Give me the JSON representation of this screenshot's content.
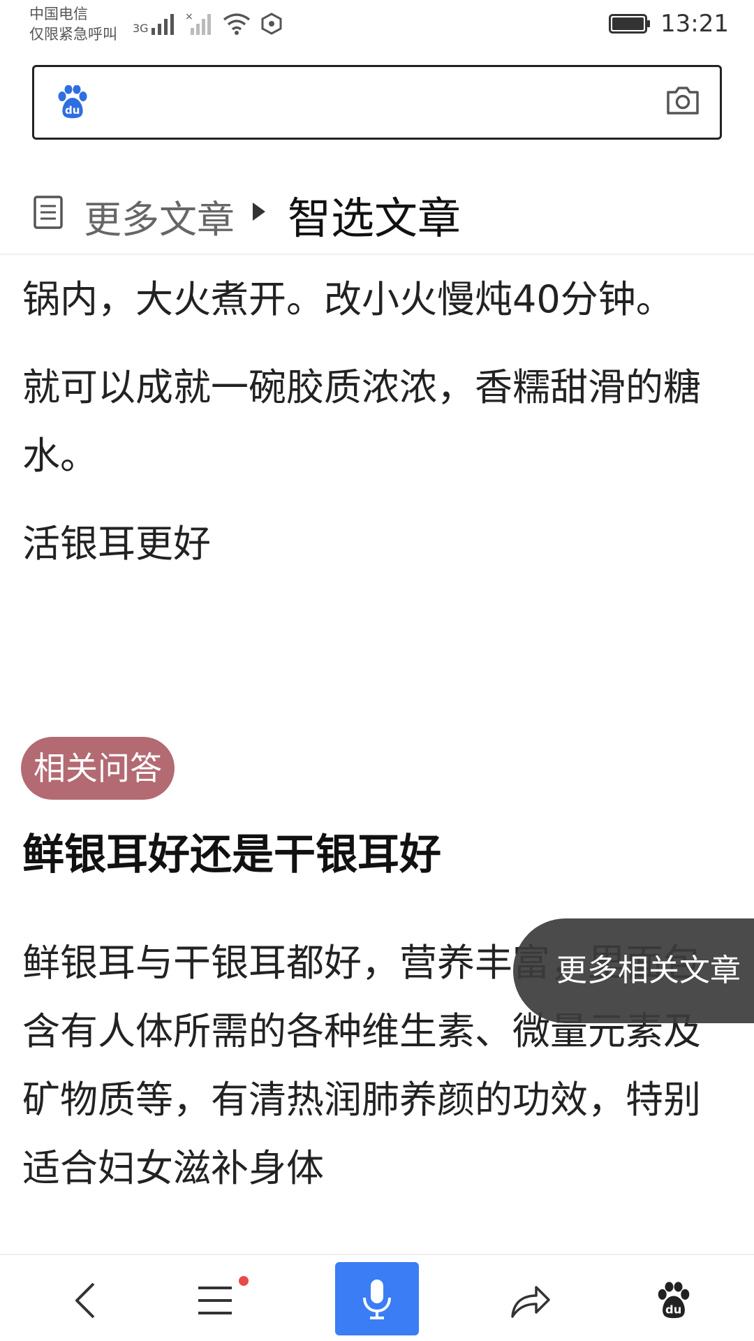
{
  "status_bar": {
    "carrier_line1": "中国电信",
    "carrier_line2": "仅限紧急呼叫",
    "network": "3G",
    "time": "13:21"
  },
  "search": {
    "placeholder": ""
  },
  "article_nav": {
    "more_articles": "更多文章",
    "current": "智选文章"
  },
  "article": {
    "paragraphs": [
      "锅内，大火煮开。改小火慢炖40分钟。",
      "就可以成就一碗胶质浓浓，香糯甜滑的糖水。",
      "活银耳更好"
    ]
  },
  "related_qa": {
    "tag": "相关问答",
    "title": "鲜银耳好还是干银耳好",
    "body": "鲜银耳与干银耳都好，营养丰富，里面包含有人体所需的各种维生素、微量元素及矿物质等，有清热润肺养颜的功效，特别适合妇女滋补身体"
  },
  "floating": {
    "more_related": "更多相关文章"
  },
  "colors": {
    "tag_bg": "#b36a72",
    "voice_button": "#3b7df5",
    "baidu_blue": "#2f6ee0",
    "notification_dot": "#e84a4a"
  },
  "icons": {
    "back": "chevron-left-icon",
    "menu": "menu-icon",
    "voice": "microphone-icon",
    "share": "share-icon",
    "home": "baidu-paw-icon",
    "camera": "camera-icon",
    "document": "document-icon"
  }
}
